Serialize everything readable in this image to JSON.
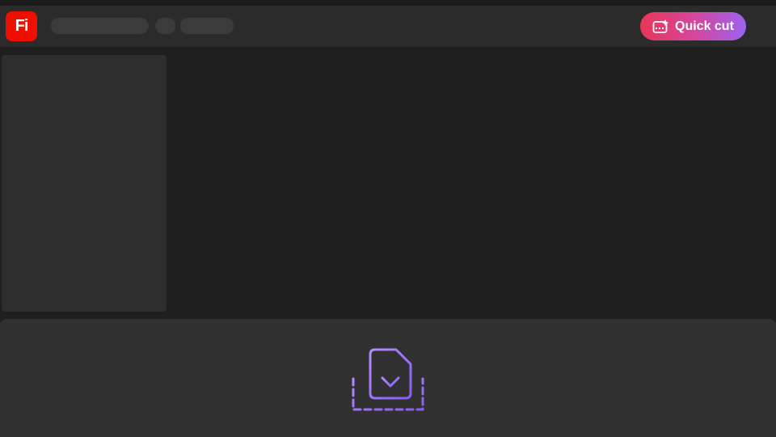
{
  "app": {
    "logo_text": "Fi",
    "brand_color": "#eb1000"
  },
  "header": {
    "quick_cut_label": "Quick cut",
    "quick_cut_icon": "quick-cut-icon",
    "quick_cut_gradient": [
      "#e8365a",
      "#9d63f0"
    ]
  },
  "timeline": {
    "import_icon": "import-file-icon"
  }
}
